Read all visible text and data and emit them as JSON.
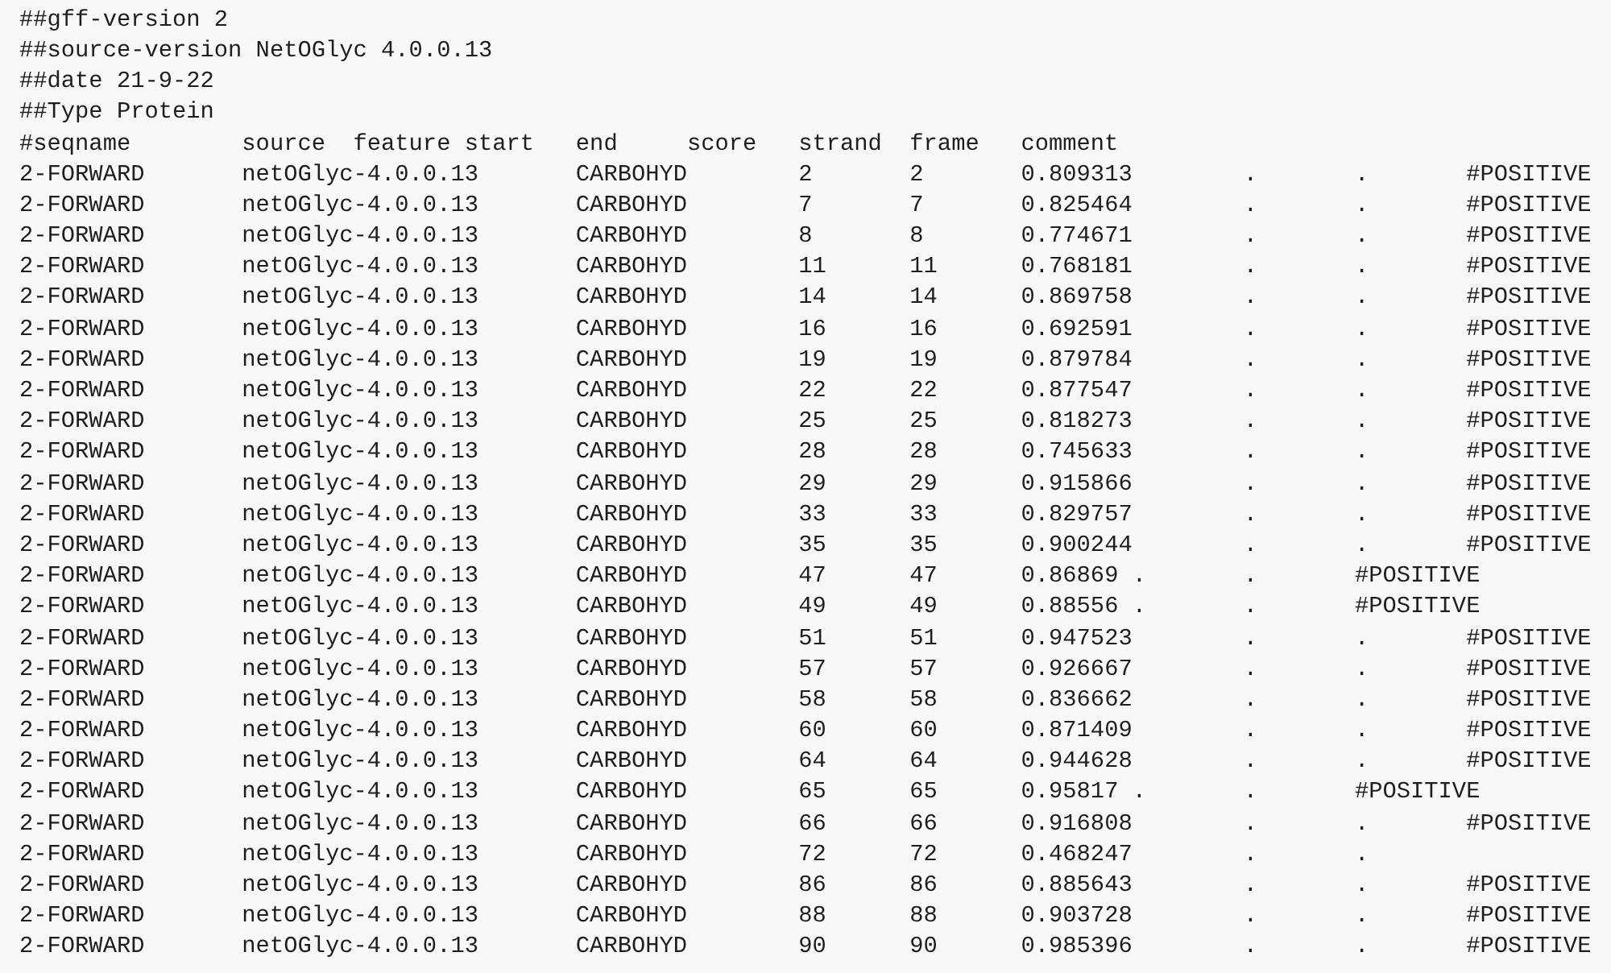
{
  "header_lines": [
    "##gff-version 2",
    "##source-version NetOGlyc 4.0.0.13",
    "##date 21-9-22",
    "##Type Protein"
  ],
  "columns": [
    "#seqname",
    "source",
    "feature start",
    "end",
    "score",
    "strand",
    "frame",
    "comment"
  ],
  "rows": [
    [
      "2-FORWARD",
      "netOGlyc-4.0.0.13",
      "CARBOHYD",
      "2",
      "2",
      "0.809313",
      ".",
      ".",
      "#POSITIVE"
    ],
    [
      "2-FORWARD",
      "netOGlyc-4.0.0.13",
      "CARBOHYD",
      "7",
      "7",
      "0.825464",
      ".",
      ".",
      "#POSITIVE"
    ],
    [
      "2-FORWARD",
      "netOGlyc-4.0.0.13",
      "CARBOHYD",
      "8",
      "8",
      "0.774671",
      ".",
      ".",
      "#POSITIVE"
    ],
    [
      "2-FORWARD",
      "netOGlyc-4.0.0.13",
      "CARBOHYD",
      "11",
      "11",
      "0.768181",
      ".",
      ".",
      "#POSITIVE"
    ],
    [
      "2-FORWARD",
      "netOGlyc-4.0.0.13",
      "CARBOHYD",
      "14",
      "14",
      "0.869758",
      ".",
      ".",
      "#POSITIVE"
    ],
    [
      "2-FORWARD",
      "netOGlyc-4.0.0.13",
      "CARBOHYD",
      "16",
      "16",
      "0.692591",
      ".",
      ".",
      "#POSITIVE"
    ],
    [
      "2-FORWARD",
      "netOGlyc-4.0.0.13",
      "CARBOHYD",
      "19",
      "19",
      "0.879784",
      ".",
      ".",
      "#POSITIVE"
    ],
    [
      "2-FORWARD",
      "netOGlyc-4.0.0.13",
      "CARBOHYD",
      "22",
      "22",
      "0.877547",
      ".",
      ".",
      "#POSITIVE"
    ],
    [
      "2-FORWARD",
      "netOGlyc-4.0.0.13",
      "CARBOHYD",
      "25",
      "25",
      "0.818273",
      ".",
      ".",
      "#POSITIVE"
    ],
    [
      "2-FORWARD",
      "netOGlyc-4.0.0.13",
      "CARBOHYD",
      "28",
      "28",
      "0.745633",
      ".",
      ".",
      "#POSITIVE"
    ],
    [
      "2-FORWARD",
      "netOGlyc-4.0.0.13",
      "CARBOHYD",
      "29",
      "29",
      "0.915866",
      ".",
      ".",
      "#POSITIVE"
    ],
    [
      "2-FORWARD",
      "netOGlyc-4.0.0.13",
      "CARBOHYD",
      "33",
      "33",
      "0.829757",
      ".",
      ".",
      "#POSITIVE"
    ],
    [
      "2-FORWARD",
      "netOGlyc-4.0.0.13",
      "CARBOHYD",
      "35",
      "35",
      "0.900244",
      ".",
      ".",
      "#POSITIVE"
    ],
    [
      "2-FORWARD",
      "netOGlyc-4.0.0.13",
      "CARBOHYD",
      "47",
      "47",
      "0.86869",
      ".",
      ".",
      "#POSITIVE"
    ],
    [
      "2-FORWARD",
      "netOGlyc-4.0.0.13",
      "CARBOHYD",
      "49",
      "49",
      "0.88556",
      ".",
      ".",
      "#POSITIVE"
    ],
    [
      "2-FORWARD",
      "netOGlyc-4.0.0.13",
      "CARBOHYD",
      "51",
      "51",
      "0.947523",
      ".",
      ".",
      "#POSITIVE"
    ],
    [
      "2-FORWARD",
      "netOGlyc-4.0.0.13",
      "CARBOHYD",
      "57",
      "57",
      "0.926667",
      ".",
      ".",
      "#POSITIVE"
    ],
    [
      "2-FORWARD",
      "netOGlyc-4.0.0.13",
      "CARBOHYD",
      "58",
      "58",
      "0.836662",
      ".",
      ".",
      "#POSITIVE"
    ],
    [
      "2-FORWARD",
      "netOGlyc-4.0.0.13",
      "CARBOHYD",
      "60",
      "60",
      "0.871409",
      ".",
      ".",
      "#POSITIVE"
    ],
    [
      "2-FORWARD",
      "netOGlyc-4.0.0.13",
      "CARBOHYD",
      "64",
      "64",
      "0.944628",
      ".",
      ".",
      "#POSITIVE"
    ],
    [
      "2-FORWARD",
      "netOGlyc-4.0.0.13",
      "CARBOHYD",
      "65",
      "65",
      "0.95817",
      ".",
      ".",
      "#POSITIVE"
    ],
    [
      "2-FORWARD",
      "netOGlyc-4.0.0.13",
      "CARBOHYD",
      "66",
      "66",
      "0.916808",
      ".",
      ".",
      "#POSITIVE"
    ],
    [
      "2-FORWARD",
      "netOGlyc-4.0.0.13",
      "CARBOHYD",
      "72",
      "72",
      "0.468247",
      ".",
      "."
    ],
    [
      "2-FORWARD",
      "netOGlyc-4.0.0.13",
      "CARBOHYD",
      "86",
      "86",
      "0.885643",
      ".",
      ".",
      "#POSITIVE"
    ],
    [
      "2-FORWARD",
      "netOGlyc-4.0.0.13",
      "CARBOHYD",
      "88",
      "88",
      "0.903728",
      ".",
      ".",
      "#POSITIVE"
    ],
    [
      "2-FORWARD",
      "netOGlyc-4.0.0.13",
      "CARBOHYD",
      "90",
      "90",
      "0.985396",
      ".",
      ".",
      "#POSITIVE"
    ]
  ]
}
